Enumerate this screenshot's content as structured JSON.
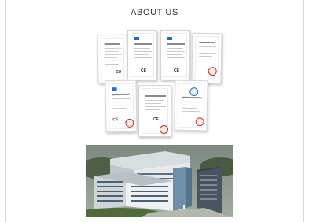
{
  "header": {
    "title": "ABOUT US"
  },
  "certificates": {
    "items": [
      {
        "name": "certificate-1"
      },
      {
        "name": "certificate-2"
      },
      {
        "name": "certificate-3"
      },
      {
        "name": "certificate-4"
      },
      {
        "name": "certificate-5"
      },
      {
        "name": "certificate-6"
      },
      {
        "name": "certificate-7"
      }
    ]
  },
  "images": {
    "building": "office-building-rendering"
  },
  "colors": {
    "background": "#ffffff",
    "title_text": "#333333",
    "rule": "#d9d9d9",
    "seal_red": "#c0392b",
    "logo_blue": "#2a6bb6"
  }
}
